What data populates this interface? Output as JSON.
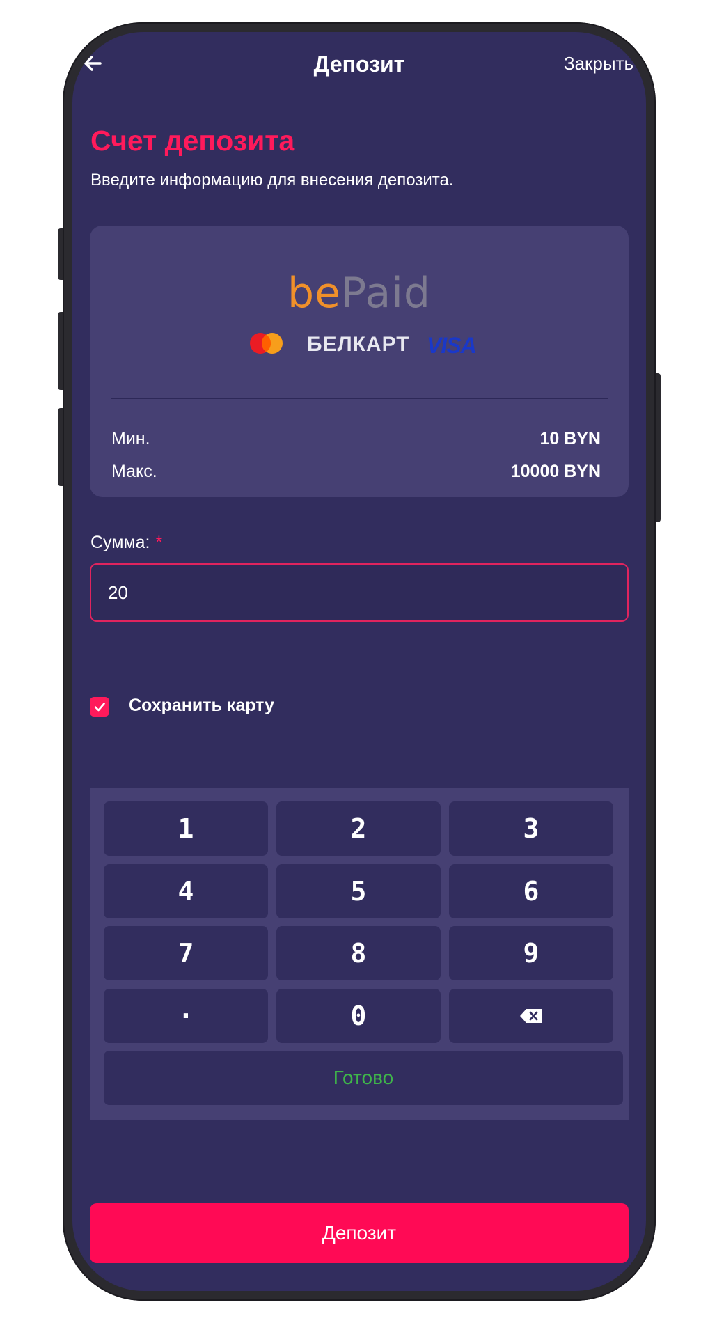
{
  "header": {
    "title": "Депозит",
    "close_label": "Закрыть"
  },
  "page": {
    "heading": "Счет депозита",
    "subtitle": "Введите информацию для внесения депозита."
  },
  "payment_method": {
    "logo_be": "be",
    "logo_paid": "Paid",
    "brands": [
      "mastercard-icon",
      "БЕЛКАРТ",
      "VISA"
    ],
    "belkart_label": "БЕЛКАРТ",
    "visa_label": "VISA",
    "min_label": "Мин.",
    "min_value": "10 BYN",
    "max_label": "Макс.",
    "max_value": "10000 BYN"
  },
  "amount": {
    "label": "Сумма:",
    "required_mark": "*",
    "value": "20"
  },
  "save_card": {
    "label": "Сохранить карту",
    "checked": true
  },
  "keypad": {
    "keys": [
      "1",
      "2",
      "3",
      "4",
      "5",
      "6",
      "7",
      "8",
      "9",
      "·",
      "0"
    ],
    "backspace_icon": "backspace-icon",
    "done_label": "Готово"
  },
  "footer": {
    "deposit_label": "Депозит"
  },
  "colors": {
    "background": "#322d5e",
    "card": "#464073",
    "accent": "#ff1a5b",
    "done_green": "#3fb54a"
  }
}
